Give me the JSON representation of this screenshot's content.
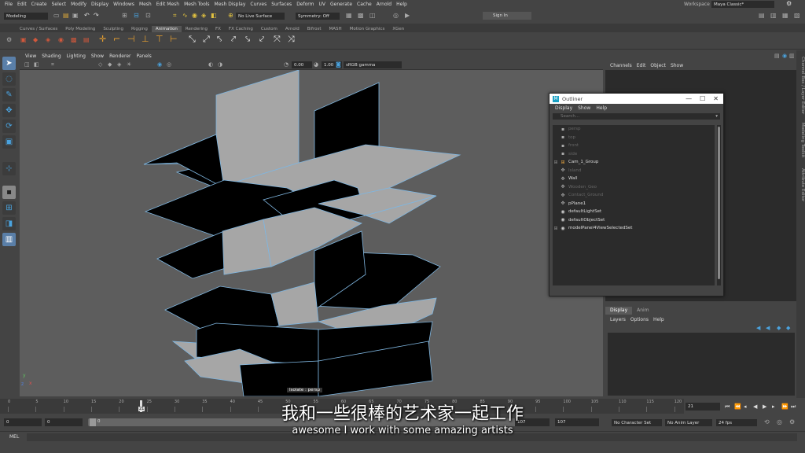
{
  "menubar": {
    "items": [
      "File",
      "Edit",
      "Create",
      "Select",
      "Modify",
      "Display",
      "Windows",
      "Mesh",
      "Edit Mesh",
      "Mesh Tools",
      "Mesh Display",
      "Curves",
      "Surfaces",
      "Deform",
      "UV",
      "Generate",
      "Cache",
      "Arnold",
      "Help"
    ],
    "workspace_label": "Workspace :",
    "workspace_value": "Maya Classic*"
  },
  "statusline": {
    "mode": "Modeling",
    "live_surface": "No Live Surface",
    "symmetry": "Symmetry: Off",
    "sign_in": "Sign In"
  },
  "shelf_tabs": [
    "Curves / Surfaces",
    "Poly Modeling",
    "Sculpting",
    "Rigging",
    "Animation",
    "Rendering",
    "FX",
    "FX Caching",
    "Custom",
    "Arnold",
    "Bifrost",
    "MASH",
    "Motion Graphics",
    "XGen"
  ],
  "shelf_active": "Animation",
  "panel_menu": [
    "View",
    "Shading",
    "Lighting",
    "Show",
    "Renderer",
    "Panels"
  ],
  "panel_toolbar": {
    "exposure": "0.00",
    "gamma": "1.00",
    "colorspace": "sRGB gamma"
  },
  "viewport": {
    "label": "Isolate : persp"
  },
  "channel_box": {
    "menu": [
      "Channels",
      "Edit",
      "Object",
      "Show"
    ]
  },
  "layer_editor": {
    "tabs": [
      "Display",
      "Anim"
    ],
    "active_tab": "Display",
    "menu": [
      "Layers",
      "Options",
      "Help"
    ]
  },
  "side_tabs": [
    "Channel Box / Layer Editor",
    "Modeling Toolkit",
    "Attribute Editor"
  ],
  "outliner": {
    "title": "Outliner",
    "menu": [
      "Display",
      "Show",
      "Help"
    ],
    "search_placeholder": "Search...",
    "items": [
      {
        "label": "persp",
        "dim": true,
        "icon": "camera-icon",
        "expand": false
      },
      {
        "label": "top",
        "dim": true,
        "icon": "camera-icon",
        "expand": false
      },
      {
        "label": "front",
        "dim": true,
        "icon": "camera-icon",
        "expand": false
      },
      {
        "label": "side",
        "dim": true,
        "icon": "camera-icon",
        "expand": false
      },
      {
        "label": "Cam_1_Group",
        "dim": false,
        "icon": "group-icon",
        "expand": true
      },
      {
        "label": "Island",
        "dim": true,
        "icon": "transform-icon",
        "expand": false
      },
      {
        "label": "Wall",
        "dim": false,
        "icon": "transform-icon",
        "expand": false
      },
      {
        "label": "Wooden_Geo",
        "dim": true,
        "icon": "transform-icon",
        "expand": false
      },
      {
        "label": "Contact_Ground",
        "dim": true,
        "icon": "transform-icon",
        "expand": false
      },
      {
        "label": "pPlane1",
        "dim": false,
        "icon": "transform-icon",
        "expand": false
      },
      {
        "label": "defaultLightSet",
        "dim": false,
        "icon": "set-icon",
        "expand": false
      },
      {
        "label": "defaultObjectSet",
        "dim": false,
        "icon": "set-icon",
        "expand": false
      },
      {
        "label": "modelPanel4ViewSelectedSet",
        "dim": false,
        "icon": "set-icon",
        "expand": true
      }
    ]
  },
  "timeline": {
    "ticks": [
      "0",
      "5",
      "10",
      "15",
      "20",
      "25",
      "30",
      "35",
      "40",
      "45",
      "50",
      "55",
      "60",
      "65",
      "70",
      "75",
      "80",
      "85",
      "90",
      "95",
      "100",
      "105",
      "110",
      "115",
      "120"
    ],
    "current_frame_marker": "21",
    "current_frame": "21"
  },
  "range": {
    "start": "0",
    "start2": "0",
    "inner_start": "0",
    "end_a": "107",
    "end_b": "107",
    "character_set": "No Character Set",
    "anim_layer": "No Anim Layer",
    "fps": "24 fps"
  },
  "command_line": {
    "label": "MEL"
  },
  "subtitles": {
    "chinese": "我和一些很棒的艺术家一起工作",
    "english": "awesome I work with some amazing artists"
  },
  "colors": {
    "accent_blue": "#4aa3df",
    "wire": "#7fb6e0",
    "selection": "#5a7fa8"
  }
}
